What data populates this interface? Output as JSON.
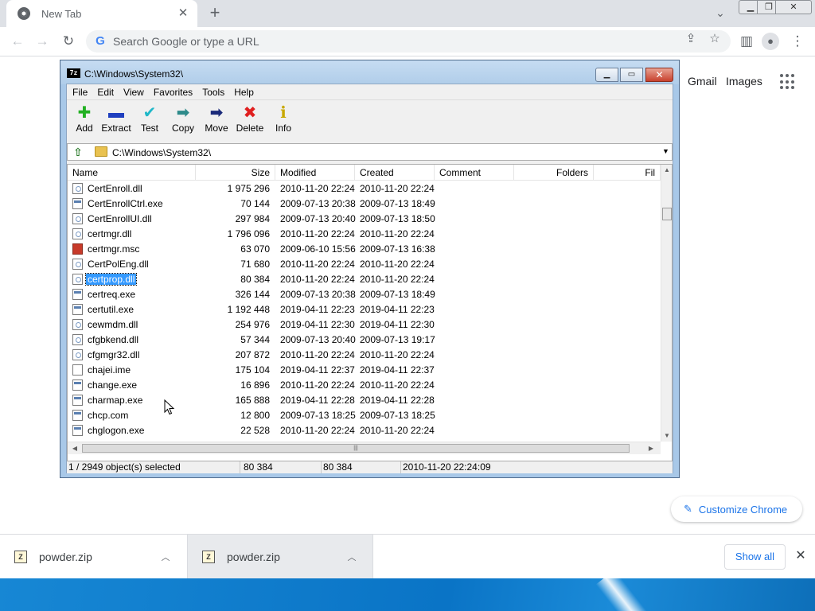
{
  "browser": {
    "tab_title": "New Tab",
    "tab_close_glyph": "✕",
    "new_tab_glyph": "+",
    "omnibox_placeholder": "Search Google or type a URL",
    "ntp_links": [
      "Gmail",
      "Images"
    ],
    "customize_label": "Customize Chrome"
  },
  "zip_window": {
    "title": "C:\\Windows\\System32\\",
    "logo_text": "7z",
    "menu": [
      "File",
      "Edit",
      "View",
      "Favorites",
      "Tools",
      "Help"
    ],
    "toolbar": [
      {
        "label": "Add",
        "glyph": "✚",
        "color": "#22b022"
      },
      {
        "label": "Extract",
        "glyph": "▬",
        "color": "#1f3fbf"
      },
      {
        "label": "Test",
        "glyph": "✔",
        "color": "#20b8c8"
      },
      {
        "label": "Copy",
        "glyph": "➡",
        "color": "#2d8a8a"
      },
      {
        "label": "Move",
        "glyph": "➡",
        "color": "#1a2a7a"
      },
      {
        "label": "Delete",
        "glyph": "✖",
        "color": "#e02020"
      },
      {
        "label": "Info",
        "glyph": "ℹ",
        "color": "#c8a800"
      }
    ],
    "address": "C:\\Windows\\System32\\",
    "columns": [
      "Name",
      "Size",
      "Modified",
      "Created",
      "Comment",
      "Folders",
      "Fil"
    ],
    "files": [
      {
        "name": "CertEnroll.dll",
        "type": "dll",
        "size": "1 975 296",
        "modified": "2010-11-20 22:24",
        "created": "2010-11-20 22:24"
      },
      {
        "name": "CertEnrollCtrl.exe",
        "type": "exe",
        "size": "70 144",
        "modified": "2009-07-13 20:38",
        "created": "2009-07-13 18:49"
      },
      {
        "name": "CertEnrollUI.dll",
        "type": "dll",
        "size": "297 984",
        "modified": "2009-07-13 20:40",
        "created": "2009-07-13 18:50"
      },
      {
        "name": "certmgr.dll",
        "type": "dll",
        "size": "1 796 096",
        "modified": "2010-11-20 22:24",
        "created": "2010-11-20 22:24"
      },
      {
        "name": "certmgr.msc",
        "type": "msc",
        "size": "63 070",
        "modified": "2009-06-10 15:56",
        "created": "2009-07-13 16:38"
      },
      {
        "name": "CertPolEng.dll",
        "type": "dll",
        "size": "71 680",
        "modified": "2010-11-20 22:24",
        "created": "2010-11-20 22:24"
      },
      {
        "name": "certprop.dll",
        "type": "dll",
        "size": "80 384",
        "modified": "2010-11-20 22:24",
        "created": "2010-11-20 22:24",
        "selected": true
      },
      {
        "name": "certreq.exe",
        "type": "exe",
        "size": "326 144",
        "modified": "2009-07-13 20:38",
        "created": "2009-07-13 18:49"
      },
      {
        "name": "certutil.exe",
        "type": "exe",
        "size": "1 192 448",
        "modified": "2019-04-11 22:23",
        "created": "2019-04-11 22:23"
      },
      {
        "name": "cewmdm.dll",
        "type": "dll",
        "size": "254 976",
        "modified": "2019-04-11 22:30",
        "created": "2019-04-11 22:30"
      },
      {
        "name": "cfgbkend.dll",
        "type": "dll",
        "size": "57 344",
        "modified": "2009-07-13 20:40",
        "created": "2009-07-13 19:17"
      },
      {
        "name": "cfgmgr32.dll",
        "type": "dll",
        "size": "207 872",
        "modified": "2010-11-20 22:24",
        "created": "2010-11-20 22:24"
      },
      {
        "name": "chajei.ime",
        "type": "file",
        "size": "175 104",
        "modified": "2019-04-11 22:37",
        "created": "2019-04-11 22:37"
      },
      {
        "name": "change.exe",
        "type": "exe",
        "size": "16 896",
        "modified": "2010-11-20 22:24",
        "created": "2010-11-20 22:24"
      },
      {
        "name": "charmap.exe",
        "type": "exe",
        "size": "165 888",
        "modified": "2019-04-11 22:28",
        "created": "2019-04-11 22:28"
      },
      {
        "name": "chcp.com",
        "type": "exe",
        "size": "12 800",
        "modified": "2009-07-13 18:25",
        "created": "2009-07-13 18:25"
      },
      {
        "name": "chglogon.exe",
        "type": "exe",
        "size": "22 528",
        "modified": "2010-11-20 22:24",
        "created": "2010-11-20 22:24"
      }
    ],
    "status": {
      "selection": "1 / 2949 object(s) selected",
      "size": "80 384",
      "packed": "80 384",
      "date": "2010-11-20 22:24:09"
    }
  },
  "downloads": {
    "items": [
      {
        "name": "powder.zip"
      },
      {
        "name": "powder.zip"
      }
    ],
    "show_all": "Show all"
  },
  "colors": {
    "selection": "#3399ff",
    "chrome_blue": "#1a73e8",
    "tabstrip": "#dee1e6"
  }
}
